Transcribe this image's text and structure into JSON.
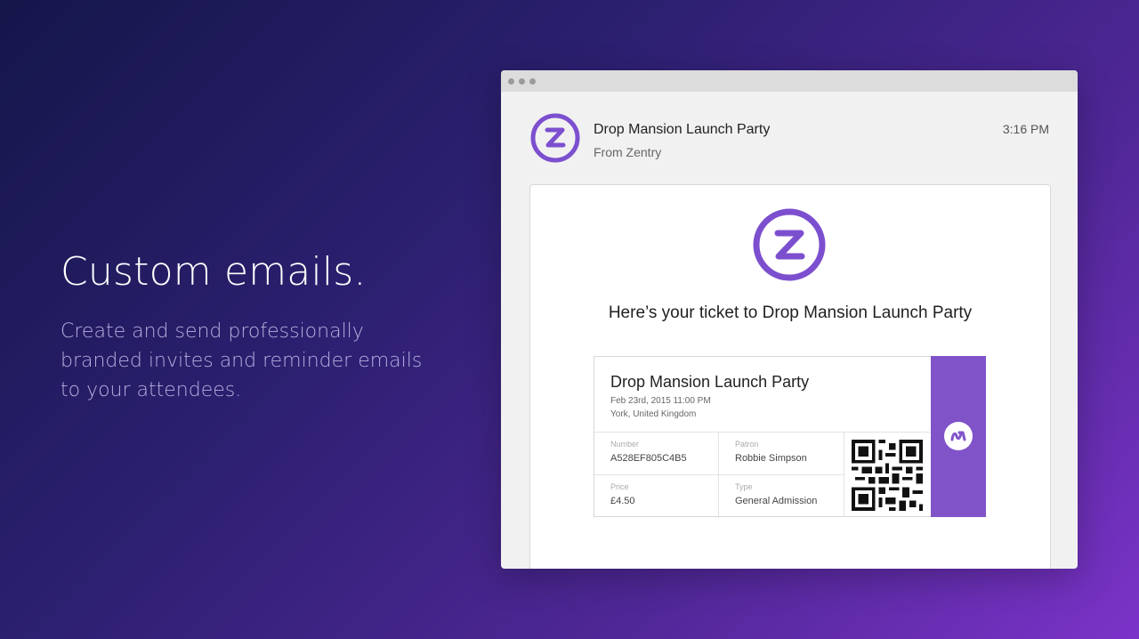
{
  "hero": {
    "title": "Custom emails.",
    "subtitle": "Create and send professionally branded invites and reminder emails to your attendees."
  },
  "email": {
    "subject": "Drop Mansion Launch Party",
    "from": "From Zentry",
    "time": "3:16 PM",
    "headline": "Here’s your ticket to Drop Mansion Launch Party"
  },
  "ticket": {
    "title": "Drop Mansion Launch Party",
    "date": "Feb 23rd, 2015  11:00 PM",
    "location": "York, United Kingdom",
    "fields": {
      "number_label": "Number",
      "number_value": "A528EF805C4B5",
      "patron_label": "Patron",
      "patron_value": "Robbie Simpson",
      "price_label": "Price",
      "price_value": "£4.50",
      "type_label": "Type",
      "type_value": "General Admission"
    }
  },
  "icons": {
    "avatar": "zentry-logo-icon",
    "qr": "qr-code-icon",
    "stub": "brand-mark-icon"
  },
  "colors": {
    "brand_purple": "#8153c9",
    "logo_purple": "#7c4fcf"
  }
}
